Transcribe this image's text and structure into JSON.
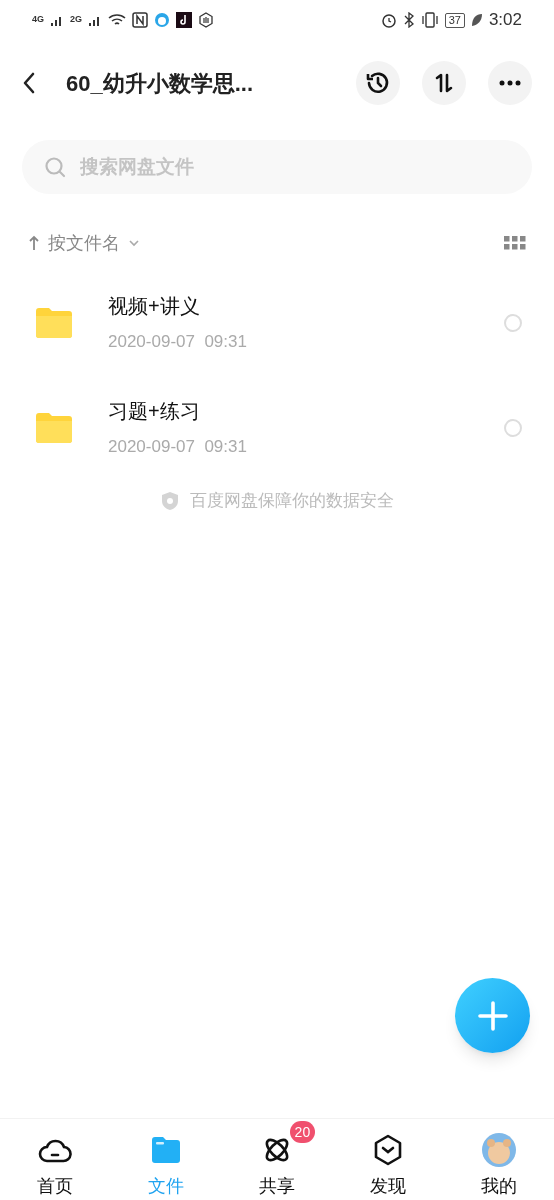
{
  "status_bar": {
    "network_1": "4G",
    "network_2": "2G",
    "battery": "37",
    "time": "3:02"
  },
  "header": {
    "title": "60_幼升小数学思..."
  },
  "search": {
    "placeholder": "搜索网盘文件"
  },
  "sort": {
    "label": "按文件名"
  },
  "files": [
    {
      "name": "视频+讲义",
      "date": "2020-09-07  09:31",
      "selected": false
    },
    {
      "name": "习题+练习",
      "date": "2020-09-07  09:31",
      "selected": false
    }
  ],
  "security_note": "百度网盘保障你的数据安全",
  "tabs": [
    {
      "label": "首页",
      "kind": "home",
      "selected": false
    },
    {
      "label": "文件",
      "kind": "files",
      "selected": true
    },
    {
      "label": "共享",
      "kind": "share",
      "selected": false,
      "badge": "20"
    },
    {
      "label": "发现",
      "kind": "discover",
      "selected": false
    },
    {
      "label": "我的",
      "kind": "me",
      "selected": false
    }
  ]
}
